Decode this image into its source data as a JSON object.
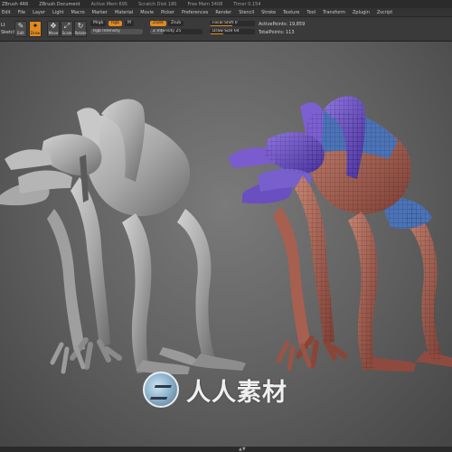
{
  "titlebar": {
    "app": "ZBrush 4R6",
    "document": "ZBrush Document",
    "active_mem": "Active Mem 695",
    "scratch_disk": "Scratch Disk 180",
    "free_mem": "Free Mem 3408",
    "timer": "Timer 0.154"
  },
  "menubar": {
    "items": [
      "Edit",
      "File",
      "Layer",
      "Light",
      "Macro",
      "Marker",
      "Material",
      "Movie",
      "Picker",
      "Preferences",
      "Render",
      "Stencil",
      "Stroke",
      "Texture",
      "Tool",
      "Transform",
      "Zplugin",
      "Zscript"
    ]
  },
  "toolbar": {
    "left_cut": "Lt",
    "left_cut2": "Sketch",
    "edit_label": "Edit",
    "draw_label": "Draw",
    "move_label": "Move",
    "scale_label": "Scale",
    "rotate_label": "Rotate",
    "mrgb": "Mrgb",
    "rgb": "Rgb",
    "m": "M",
    "rgb_intensity": "Rgb Intensity",
    "zadd": "Zadd",
    "zsub": "Zsub",
    "z_intensity": "Z Intensity 25",
    "focal_shift": "Focal Shift 0",
    "draw_size": "Draw Size 64",
    "active_points": "ActivePoints: 19,859",
    "total_points": "TotalPoints: 113"
  },
  "icons": {
    "move": "move-icon",
    "scale": "scale-icon",
    "rotate": "rotate-icon",
    "edit": "edit-icon",
    "draw": "draw-icon"
  },
  "colors": {
    "accent": "#e08a1e",
    "clay": "#a9a9a9",
    "poly_purple": "#6a4fc0",
    "poly_skin": "#b0695a",
    "poly_blue": "#4b73b8"
  },
  "watermark": {
    "text": "人人素材"
  },
  "bottombar": {
    "indicator": "▲▼"
  }
}
